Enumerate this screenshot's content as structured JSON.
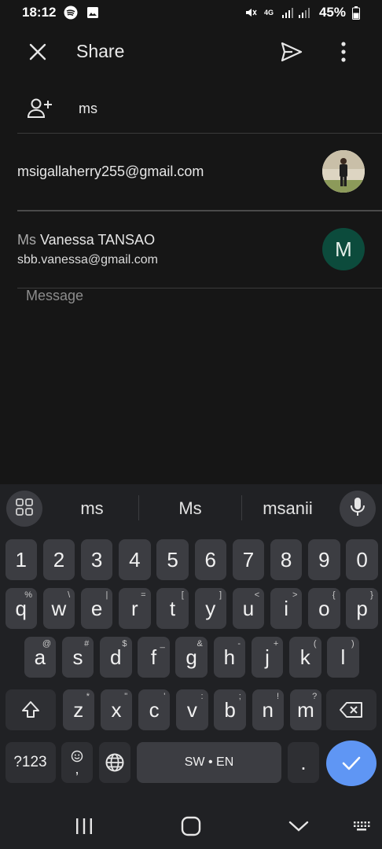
{
  "status_bar": {
    "time": "18:12",
    "battery": "45%",
    "network": "4G",
    "icons": [
      "spotify-icon",
      "gallery-icon",
      "mute-icon",
      "signal-icon",
      "battery-icon"
    ]
  },
  "appbar": {
    "title": "Share",
    "icons": [
      "close-icon",
      "send-icon",
      "more-vert-icon"
    ]
  },
  "to_field": {
    "value": "ms",
    "icon": "person-add-icon"
  },
  "suggestions": [
    {
      "email": "msigallaherry255@gmail.com",
      "avatar": "photo"
    },
    {
      "name_match": "Ms",
      "name_rest": " Vanessa TANSAO",
      "email": "sbb.vanessa@gmail.com",
      "avatar_letter": "M"
    }
  ],
  "message": {
    "placeholder": "Message"
  },
  "keyboard": {
    "suggestions": [
      "ms",
      "Ms",
      "msanii"
    ],
    "row_numbers": [
      "1",
      "2",
      "3",
      "4",
      "5",
      "6",
      "7",
      "8",
      "9",
      "0"
    ],
    "row1": [
      {
        "k": "q",
        "h": "%"
      },
      {
        "k": "w",
        "h": "\\"
      },
      {
        "k": "e",
        "h": "|"
      },
      {
        "k": "r",
        "h": "="
      },
      {
        "k": "t",
        "h": "["
      },
      {
        "k": "y",
        "h": "]"
      },
      {
        "k": "u",
        "h": "<"
      },
      {
        "k": "i",
        "h": ">"
      },
      {
        "k": "o",
        "h": "{"
      },
      {
        "k": "p",
        "h": "}"
      }
    ],
    "row2": [
      {
        "k": "a",
        "h": "@"
      },
      {
        "k": "s",
        "h": "#"
      },
      {
        "k": "d",
        "h": "$"
      },
      {
        "k": "f",
        "h": "_"
      },
      {
        "k": "g",
        "h": "&"
      },
      {
        "k": "h",
        "h": "-"
      },
      {
        "k": "j",
        "h": "+"
      },
      {
        "k": "k",
        "h": "("
      },
      {
        "k": "l",
        "h": ")"
      }
    ],
    "row3": [
      {
        "k": "z",
        "h": "*"
      },
      {
        "k": "x",
        "h": "\""
      },
      {
        "k": "c",
        "h": "'"
      },
      {
        "k": "v",
        "h": ":"
      },
      {
        "k": "b",
        "h": ";"
      },
      {
        "k": "n",
        "h": "!"
      },
      {
        "k": "m",
        "h": "?"
      }
    ],
    "symbols_label": "?123",
    "comma_label": ",",
    "space_label": "SW • EN",
    "period_label": ".",
    "accent_color": "#5f96f4"
  },
  "navbar": {
    "icons": [
      "recents-icon",
      "home-icon",
      "back-icon",
      "keyboard-switch-icon"
    ]
  }
}
